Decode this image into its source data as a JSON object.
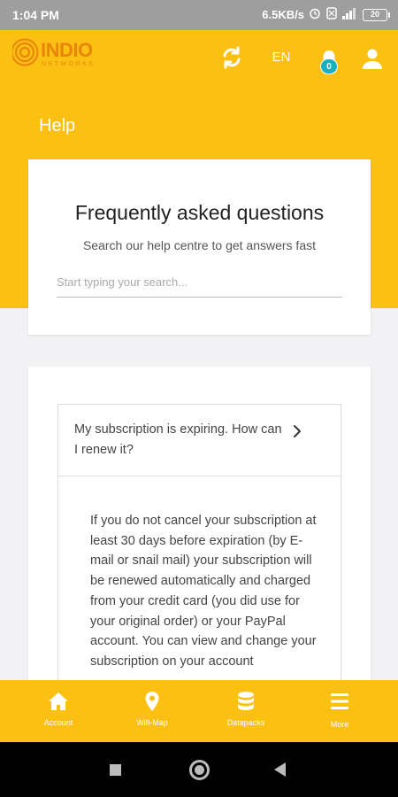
{
  "status_bar": {
    "time": "1:04 PM",
    "speed": "6.5KB/s",
    "battery": "20"
  },
  "app_bar": {
    "logo_text": "INDIO",
    "logo_sub": "NETWORKS",
    "language": "EN",
    "notification_count": "0",
    "accent_color": "#fcc012"
  },
  "page": {
    "title": "Help"
  },
  "faq": {
    "title": "Frequently asked questions",
    "subtitle": "Search our help centre to get answers fast",
    "search_placeholder": "Start typing your search..."
  },
  "qa": {
    "question": "My subscription is expiring. How can I renew it?",
    "answer": "If you do not cancel your subscription at least 30 days before expiration (by E-mail or snail mail) your subscription will be renewed automatically and charged from your credit card (you did use for your original order) or your PayPal account. You can view and change your subscription on your account"
  },
  "bottom_nav": {
    "items": [
      {
        "label": "Account",
        "icon": "home-icon"
      },
      {
        "label": "Wifi-Map",
        "icon": "map-pin-icon"
      },
      {
        "label": "Datapacks",
        "icon": "database-icon"
      },
      {
        "label": "More",
        "icon": "menu-icon"
      }
    ]
  }
}
